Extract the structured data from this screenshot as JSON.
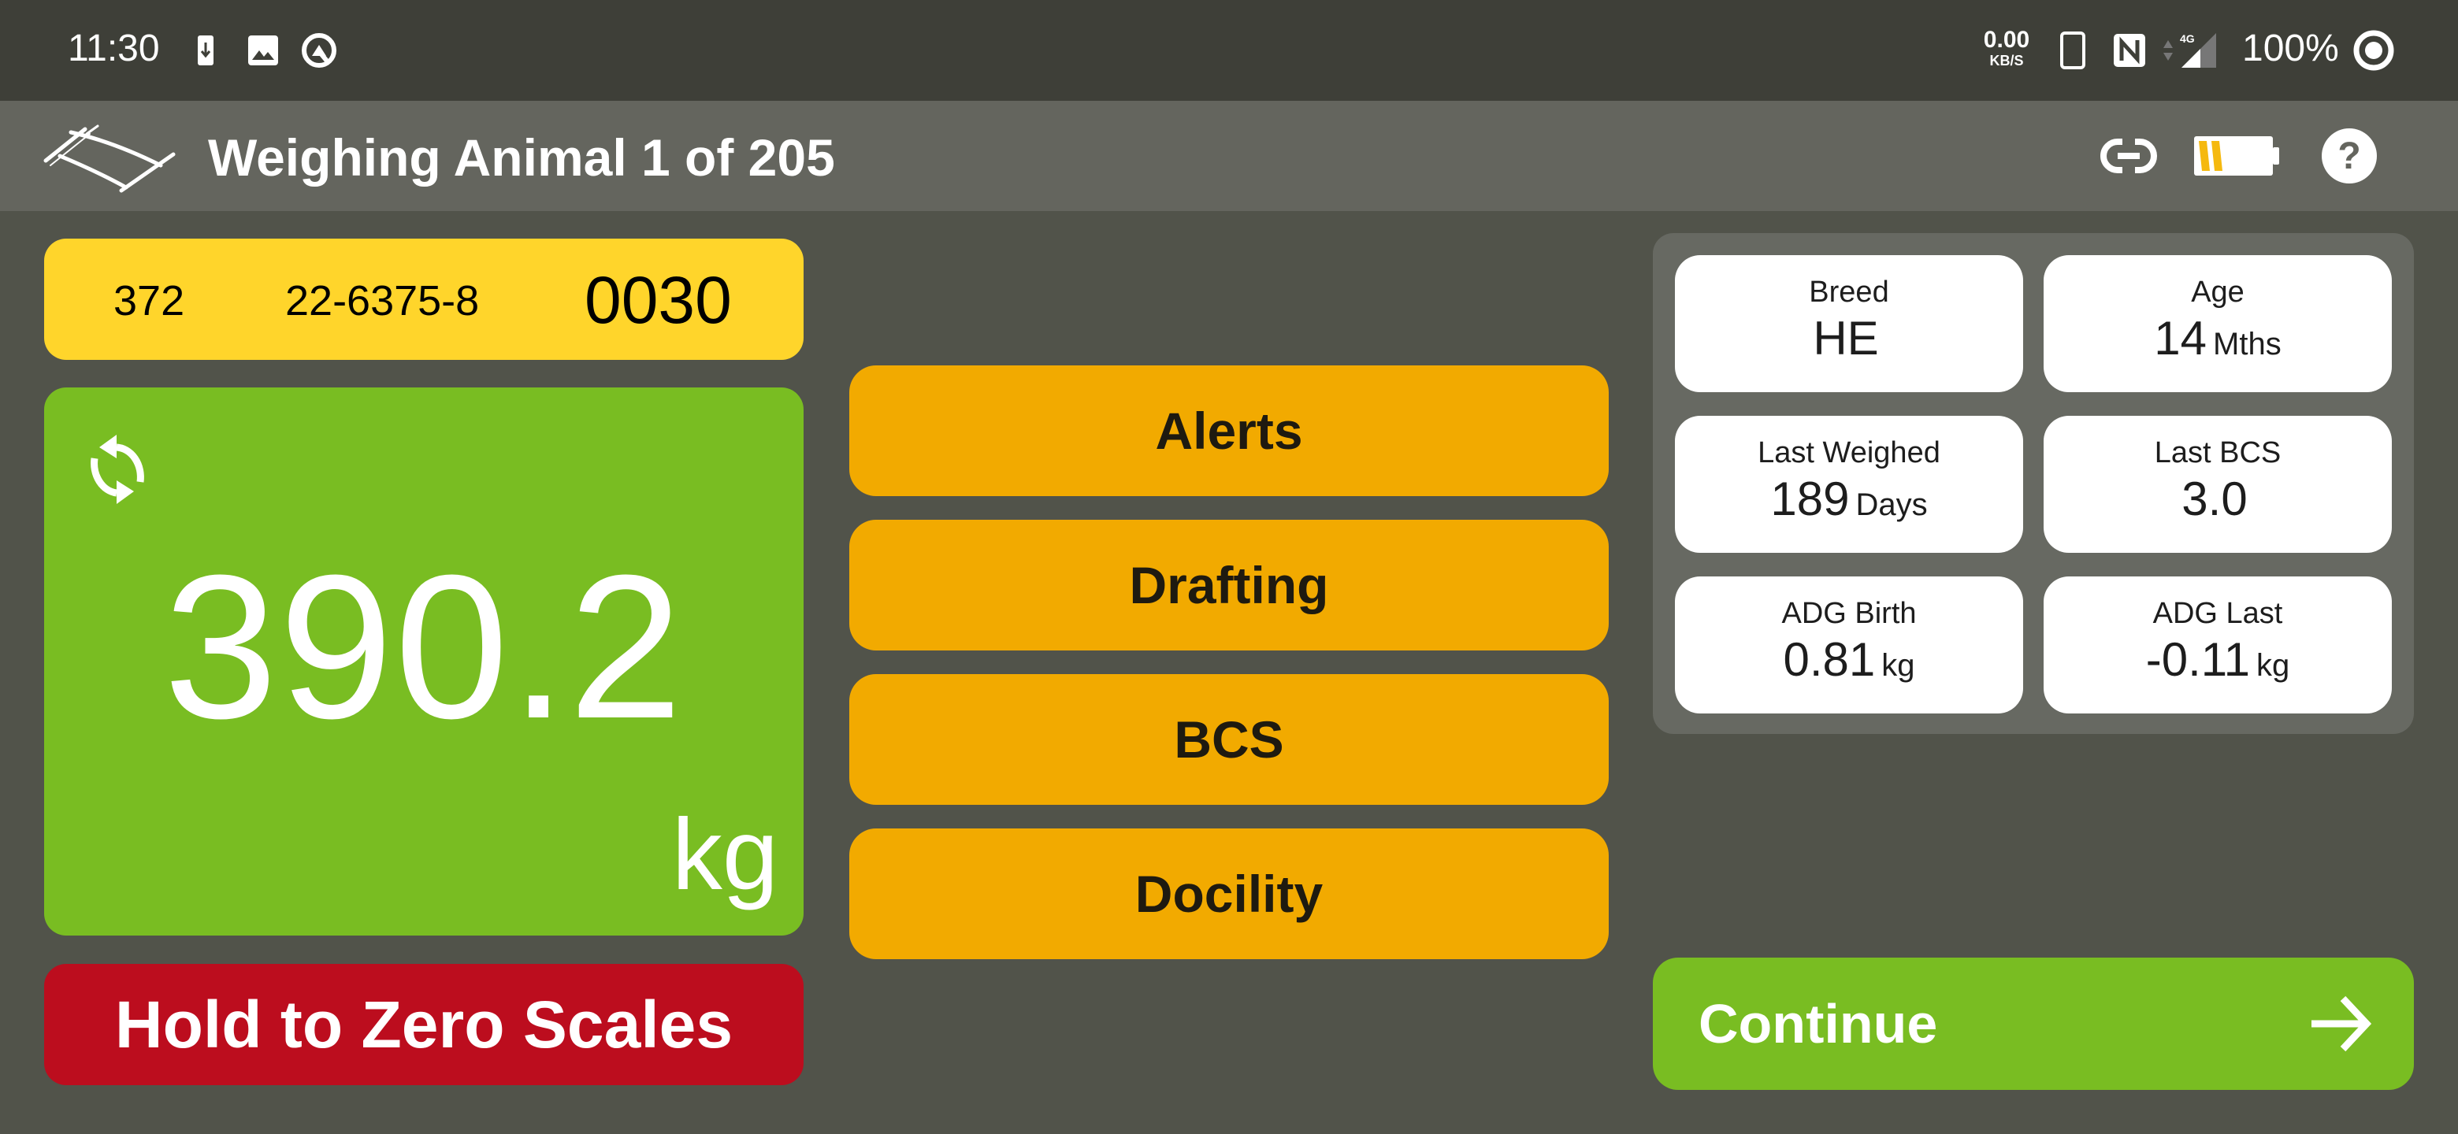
{
  "status_bar": {
    "time": "11:30",
    "left_icons": [
      "download-notification-icon",
      "image-notification-icon",
      "app-notification-icon"
    ],
    "network_speed_value": "0.00",
    "network_speed_unit": "KB/S",
    "network_type": "4G",
    "right_icons": [
      "phone-icon",
      "nfc-icon",
      "data-arrows-icon",
      "signal-icon",
      "battery-circle-icon"
    ],
    "battery_percent": "100%"
  },
  "app_bar": {
    "title": "Weighing Animal 1 of 205",
    "icons": [
      "logo-icon",
      "link-icon",
      "scale-battery-icon",
      "help-icon"
    ],
    "scale_battery_level": 0.35
  },
  "animal_tags": {
    "visual_id": "372",
    "nlis_id": "22-6375-8",
    "eid_tail": "0030"
  },
  "weight": {
    "value": "390.2",
    "unit": "kg",
    "refresh_icon": "refresh-icon"
  },
  "zero_button": {
    "label": "Hold to Zero Scales"
  },
  "actions": [
    {
      "label": "Alerts"
    },
    {
      "label": "Drafting"
    },
    {
      "label": "BCS"
    },
    {
      "label": "Docility"
    }
  ],
  "info": [
    {
      "label": "Breed",
      "value": "HE",
      "unit": ""
    },
    {
      "label": "Age",
      "value": "14",
      "unit": "Mths"
    },
    {
      "label": "Last Weighed",
      "value": "189",
      "unit": "Days"
    },
    {
      "label": "Last BCS",
      "value": "3.0",
      "unit": ""
    },
    {
      "label": "ADG Birth",
      "value": "0.81",
      "unit": "kg"
    },
    {
      "label": "ADG Last",
      "value": "-0.11",
      "unit": "kg"
    }
  ],
  "continue_button": {
    "label": "Continue"
  },
  "colors": {
    "status_bar_bg": "#3e3f38",
    "app_bar_bg": "#64655e",
    "page_bg": "#51534a",
    "tag_bar": "#ffd52b",
    "weight_ok": "#79bd22",
    "zero_button": "#bc0d1e",
    "action_button": "#f2aa00",
    "continue_button": "#79bd22",
    "battery_fill": "#f5b90f"
  }
}
